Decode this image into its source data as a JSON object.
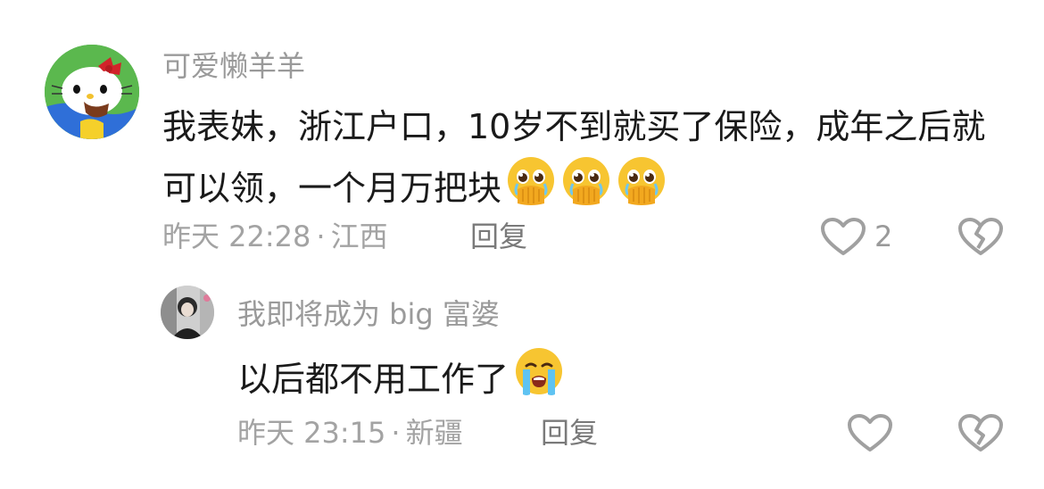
{
  "comments": [
    {
      "username": "可爱懒羊羊",
      "text": "我表妹，浙江户口，10岁不到就买了保险，成年之后就可以领，一个月万把块",
      "emoji": [
        "hands-over-mouth-teary-emoji",
        "hands-over-mouth-teary-emoji",
        "hands-over-mouth-teary-emoji"
      ],
      "time": "昨天 22:28",
      "location": "江西",
      "reply_label": "回复",
      "like_count": "2"
    },
    {
      "username": "我即将成为 big 富婆",
      "text": "以后都不用工作了",
      "emoji": [
        "loudly-crying-emoji"
      ],
      "time": "昨天 23:15",
      "location": "新疆",
      "reply_label": "回复",
      "like_count": ""
    }
  ],
  "meta_separator": "·",
  "icons": {
    "like": "heart-outline-icon",
    "dislike": "broken-heart-icon"
  },
  "colors": {
    "text": "#1a1a1a",
    "secondary": "#9a9a9a",
    "icon": "#a0a0a0"
  }
}
